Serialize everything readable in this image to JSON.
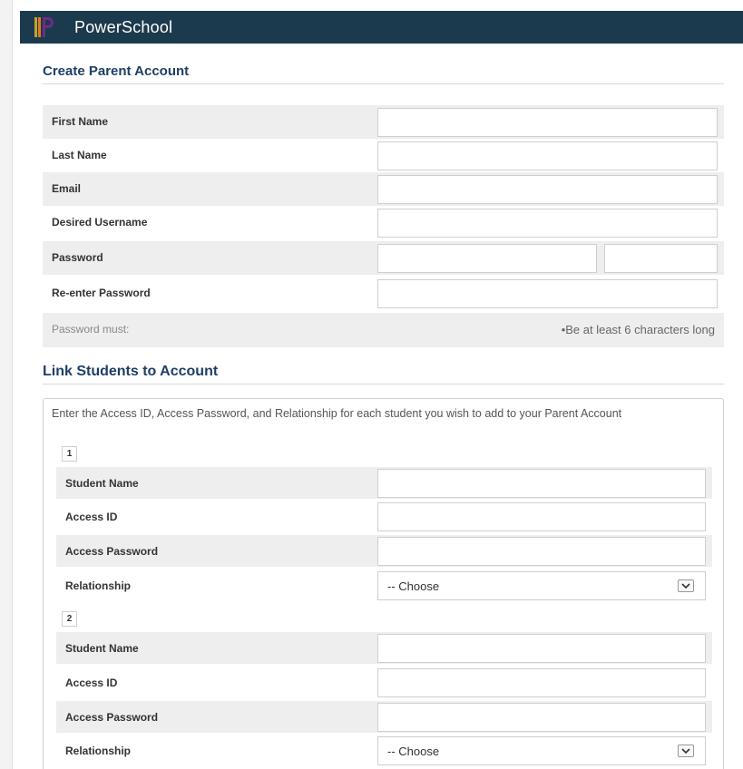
{
  "header": {
    "brand": "PowerSchool"
  },
  "create_section": {
    "title": "Create Parent Account",
    "fields": [
      {
        "label": "First Name",
        "value": ""
      },
      {
        "label": "Last Name",
        "value": ""
      },
      {
        "label": "Email",
        "value": ""
      },
      {
        "label": "Desired Username",
        "value": ""
      },
      {
        "label": "Password",
        "value": "",
        "confirm_value": ""
      },
      {
        "label": "Re-enter Password",
        "value": ""
      }
    ],
    "password_rules": {
      "label": "Password must:",
      "rule": "•Be at least 6 characters long"
    }
  },
  "link_section": {
    "title": "Link Students to Account",
    "intro": "Enter the Access ID, Access Password, and Relationship for each student you wish to add to your Parent Account",
    "students": [
      {
        "number": "1",
        "student_name_label": "Student Name",
        "access_id_label": "Access ID",
        "access_password_label": "Access Password",
        "relationship_label": "Relationship",
        "relationship_value": "-- Choose"
      },
      {
        "number": "2",
        "student_name_label": "Student Name",
        "access_id_label": "Access ID",
        "access_password_label": "Access Password",
        "relationship_label": "Relationship",
        "relationship_value": "-- Choose"
      }
    ]
  },
  "colors": {
    "header_bg": "#1c3a4d",
    "section_title": "#1f3f66",
    "row_shade": "#eeeeee"
  }
}
